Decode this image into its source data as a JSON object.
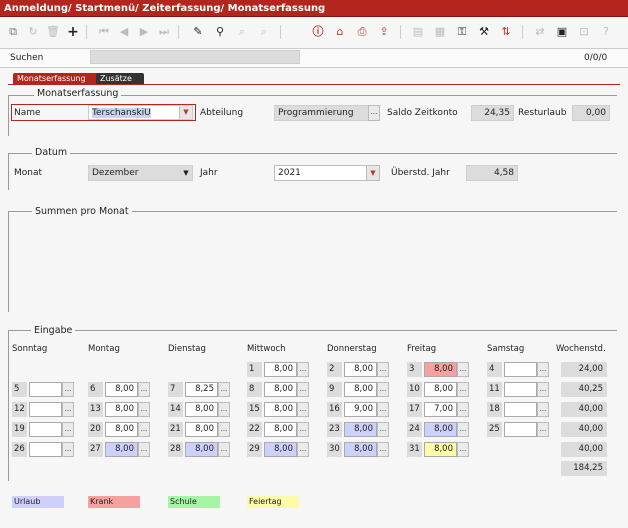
{
  "window": {
    "title": "Anmeldung/ Startmenü/ Zeiterfassung/ Monatserfassung"
  },
  "search": {
    "label": "Suchen",
    "counter": "0/0/0"
  },
  "tabs": [
    {
      "label": "Monatserfassung",
      "active": true
    },
    {
      "label": "Zusätze",
      "active": false
    }
  ],
  "monatserfassung": {
    "title": "Monatserfassung",
    "name_label": "Name",
    "name_value": "TerschanskiU",
    "abteilung_label": "Abteilung",
    "abteilung_value": "Programmierung",
    "saldo_label": "Saldo Zeitkonto",
    "saldo_value": "24,35",
    "resturlaub_label": "Resturlaub",
    "resturlaub_value": "0,00"
  },
  "datum": {
    "title": "Datum",
    "monat_label": "Monat",
    "monat_value": "Dezember",
    "jahr_label": "Jahr",
    "jahr_value": "2021",
    "ueberstd_label": "Überstd. Jahr",
    "ueberstd_value": "4,58"
  },
  "summen": {
    "title": "Summen pro Monat"
  },
  "eingabe": {
    "title": "Eingabe",
    "headers": [
      "Sonntag",
      "Montag",
      "Dienstag",
      "Mittwoch",
      "Donnerstag",
      "Freitag",
      "Samstag",
      "Wochenstd."
    ],
    "rows": [
      {
        "cells": [
          null,
          null,
          null,
          {
            "d": "1",
            "v": "8,00",
            "t": ""
          },
          {
            "d": "2",
            "v": "8,00",
            "t": ""
          },
          {
            "d": "3",
            "v": "8,00",
            "t": "krank"
          },
          {
            "d": "4",
            "v": "",
            "t": ""
          }
        ],
        "week": "24,00"
      },
      {
        "cells": [
          {
            "d": "5",
            "v": "",
            "t": ""
          },
          {
            "d": "6",
            "v": "8,00",
            "t": ""
          },
          {
            "d": "7",
            "v": "8,25",
            "t": ""
          },
          {
            "d": "8",
            "v": "8,00",
            "t": ""
          },
          {
            "d": "9",
            "v": "8,00",
            "t": ""
          },
          {
            "d": "10",
            "v": "8,00",
            "t": ""
          },
          {
            "d": "11",
            "v": "",
            "t": ""
          }
        ],
        "week": "40,25"
      },
      {
        "cells": [
          {
            "d": "12",
            "v": "",
            "t": ""
          },
          {
            "d": "13",
            "v": "8,00",
            "t": ""
          },
          {
            "d": "14",
            "v": "8,00",
            "t": ""
          },
          {
            "d": "15",
            "v": "8,00",
            "t": ""
          },
          {
            "d": "16",
            "v": "9,00",
            "t": ""
          },
          {
            "d": "17",
            "v": "7,00",
            "t": ""
          },
          {
            "d": "18",
            "v": "",
            "t": ""
          }
        ],
        "week": "40,00"
      },
      {
        "cells": [
          {
            "d": "19",
            "v": "",
            "t": ""
          },
          {
            "d": "20",
            "v": "8,00",
            "t": ""
          },
          {
            "d": "21",
            "v": "8,00",
            "t": ""
          },
          {
            "d": "22",
            "v": "8,00",
            "t": ""
          },
          {
            "d": "23",
            "v": "8,00",
            "t": "urlaub"
          },
          {
            "d": "24",
            "v": "8,00",
            "t": "urlaub"
          },
          {
            "d": "25",
            "v": "",
            "t": ""
          }
        ],
        "week": "40,00"
      },
      {
        "cells": [
          {
            "d": "26",
            "v": "",
            "t": ""
          },
          {
            "d": "27",
            "v": "8,00",
            "t": "urlaub"
          },
          {
            "d": "28",
            "v": "8,00",
            "t": "urlaub"
          },
          {
            "d": "29",
            "v": "8,00",
            "t": "urlaub"
          },
          {
            "d": "30",
            "v": "8,00",
            "t": "urlaub"
          },
          {
            "d": "31",
            "v": "8,00",
            "t": "feiertag"
          },
          null
        ],
        "week": "40,00"
      }
    ],
    "total": "184,25",
    "btn": "..."
  },
  "legend": [
    {
      "label": "Urlaub",
      "color": "#cfcffb"
    },
    {
      "label": "Krank",
      "color": "#f6a0a0"
    },
    {
      "label": "Schule",
      "color": "#a6f5a6"
    },
    {
      "label": "Feiertag",
      "color": "#fbfba8"
    }
  ],
  "colors": {
    "title_bar": "#b3261e",
    "urlaub": "#cfcffb",
    "krank": "#f6a0a0",
    "feiertag": "#fbfba8"
  }
}
